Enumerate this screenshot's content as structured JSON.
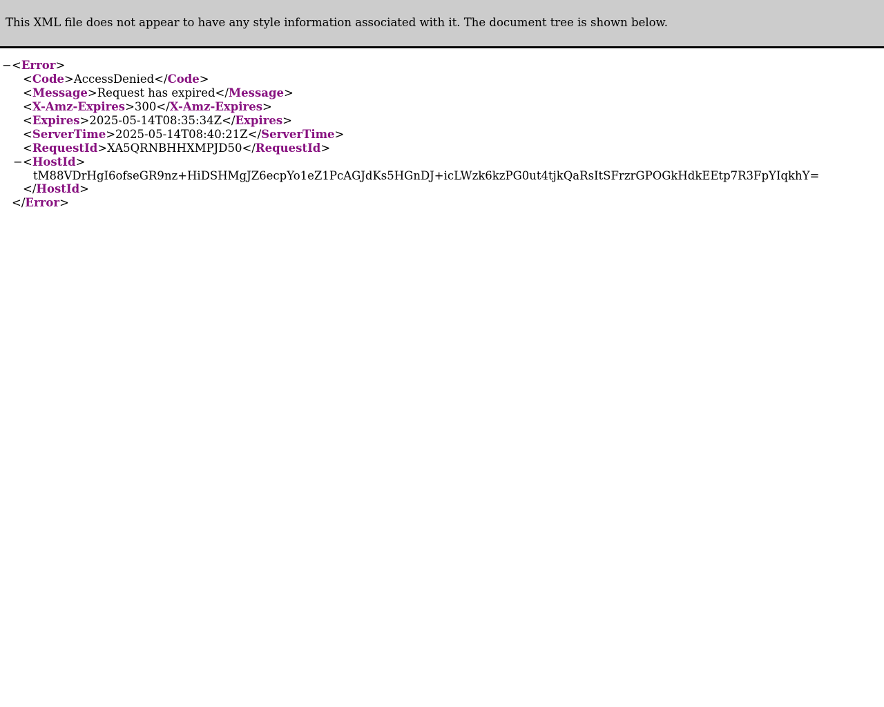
{
  "banner": {
    "text": "This XML file does not appear to have any style information associated with it. The document tree is shown below."
  },
  "tree": {
    "collapse_glyph": "−",
    "lt": "<",
    "gt": ">",
    "lt_slash": "</",
    "root_tag": "Error",
    "children": [
      {
        "tag": "Code",
        "value": "AccessDenied"
      },
      {
        "tag": "Message",
        "value": "Request has expired"
      },
      {
        "tag": "X-Amz-Expires",
        "value": "300"
      },
      {
        "tag": "Expires",
        "value": "2025-05-14T08:35:34Z"
      },
      {
        "tag": "ServerTime",
        "value": "2025-05-14T08:40:21Z"
      },
      {
        "tag": "RequestId",
        "value": "XA5QRNBHHXMPJD50"
      }
    ],
    "host": {
      "tag": "HostId",
      "value": "tM88VDrHgI6ofseGR9nz+HiDSHMgJZ6ecpYo1eZ1PcAGJdKs5HGnDJ+icLWzk6kzPG0ut4tjkQaRsItSFrzrGPOGkHdkEEtp7R3FpYIqkhY="
    }
  }
}
